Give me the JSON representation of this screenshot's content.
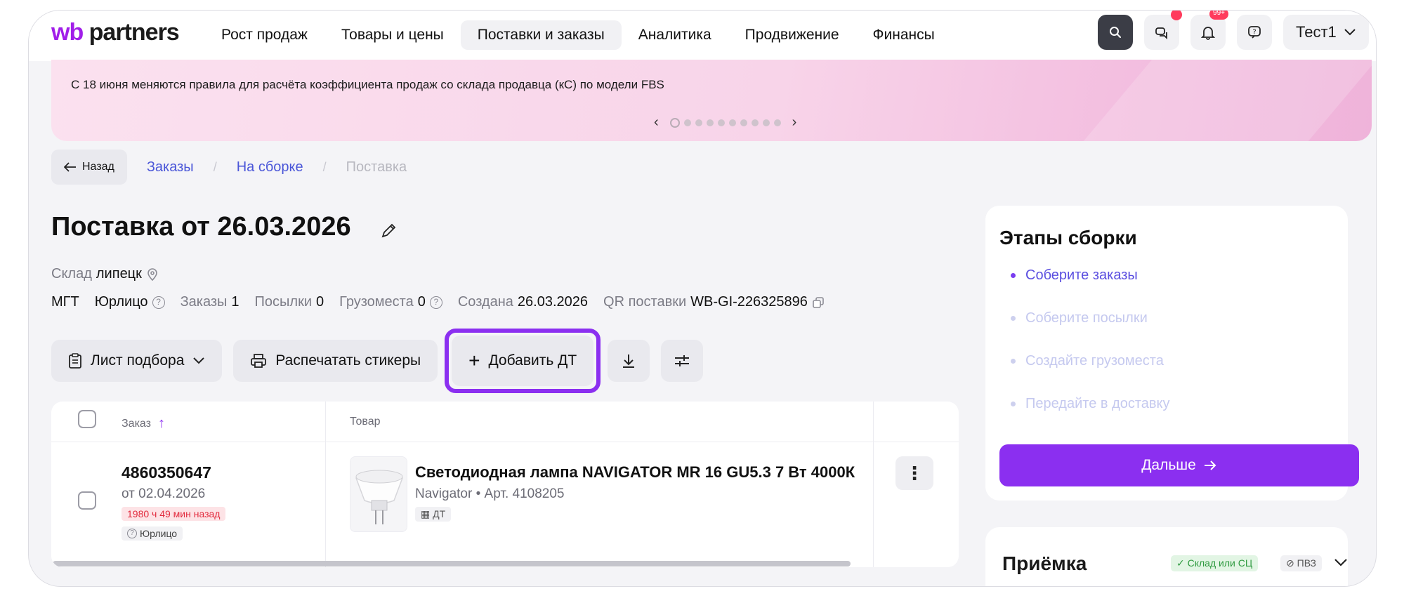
{
  "logo": {
    "wb": "wb",
    "partners": " partners"
  },
  "nav": {
    "items": [
      "Рост продаж",
      "Товары и цены",
      "Поставки и заказы",
      "Аналитика",
      "Продвижение",
      "Финансы"
    ],
    "active": 2,
    "user": "Тест1",
    "icons": [
      "search-icon",
      "chat-icon",
      "bell-icon",
      "help-icon"
    ],
    "notification_badge": "99+"
  },
  "banner": {
    "text": "С 18 июня меняются правила для расчёта коэффициента продаж со склада продавца (кС) по модели FBS",
    "slides": 10,
    "active_slide": 0
  },
  "breadcrumb": {
    "back": "Назад",
    "items": [
      "Заказы",
      "На сборке",
      "Поставка"
    ],
    "separator": "/"
  },
  "supply": {
    "title": "Поставка от 26.03.2026",
    "warehouse_label": "Склад",
    "warehouse_value": "липецк",
    "meta": {
      "mgt": "МГТ",
      "legal": "Юрлицо",
      "orders_label": "Заказы",
      "orders_value": "1",
      "parcels_label": "Посылки",
      "parcels_value": "0",
      "cargo_label": "Грузоместа",
      "cargo_value": "0",
      "created_label": "Создана",
      "created_value": "26.03.2026",
      "qr_label": "QR поставки",
      "qr_value": "WB-GI-226325896"
    }
  },
  "toolbar": {
    "pick_list": "Лист подбора",
    "print_stickers": "Распечатать стикеры",
    "add_dt": "Добавить ДТ"
  },
  "table": {
    "col_order": "Заказ",
    "col_item": "Товар",
    "rows": [
      {
        "order": "4860350647",
        "date": "от 02.04.2026",
        "late": "1980 ч 49 мин назад",
        "type": "Юрлицо",
        "product": "Светодиодная лампа NAVIGATOR MR 16 GU5.3 7 Вт 4000К",
        "brand_article": "Navigator • Арт. 4108205",
        "tag": "ДТ"
      }
    ]
  },
  "stages": {
    "title": "Этапы сборки",
    "items": [
      "Соберите заказы",
      "Соберите посылки",
      "Создайте грузоместа",
      "Передайте в доставку"
    ],
    "active": 0,
    "next": "Дальше"
  },
  "acceptance": {
    "title": "Приёмка",
    "chip_ok": "Склад или СЦ",
    "chip_no": "ПВЗ"
  },
  "colors": {
    "accent": "#8b2ff0",
    "link": "#4a56d8",
    "danger": "#e22b3e",
    "success": "#2e9a3f"
  }
}
